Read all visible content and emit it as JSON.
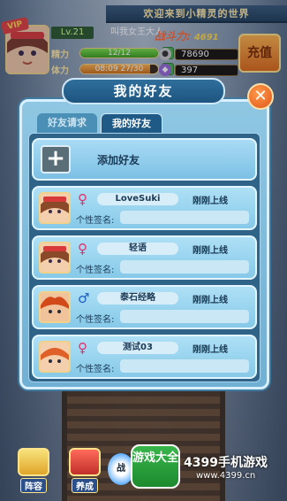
{
  "hud": {
    "banner": "欢迎来到小精灵的世界",
    "vip": "VIP",
    "level": "Lv.21",
    "player_name": "叫我女王大人",
    "power_label": "战斗力:",
    "power_value": "4691",
    "stamina_label": "精力",
    "stamina_text": "12/12",
    "stamina_fraction": 1.0,
    "energy_label": "体力",
    "energy_text": "08:09 27/30",
    "energy_fraction": 0.9,
    "plus": "+",
    "coins": "78690",
    "gems": "397",
    "recharge": "充值"
  },
  "modal": {
    "title": "我的好友",
    "close": "✕",
    "tabs": [
      "好友请求",
      "我的好友"
    ],
    "add_friend": "添加好友",
    "add_icon": "+",
    "signature_label": "个性签名:",
    "friends": [
      {
        "gender": "♀",
        "gender_color": "#d9336b",
        "name": "LoveSuki",
        "status": "刚刚上线"
      },
      {
        "gender": "♀",
        "gender_color": "#d9336b",
        "name": "轻语",
        "status": "刚刚上线"
      },
      {
        "gender": "♂",
        "gender_color": "#1f5fc0",
        "name": "泰石经略",
        "status": "刚刚上线"
      },
      {
        "gender": "♀",
        "gender_color": "#d9336b",
        "name": "测试03",
        "status": "刚刚上线"
      }
    ]
  },
  "bottom": {
    "lineup": "阵容",
    "cultivate": "养成",
    "battle": "战",
    "game_badge": "游戏大全",
    "brand": "4399手机游戏",
    "brand_url": "www.4399.cn"
  },
  "colors": {
    "accent": "#1f5a86",
    "panel": "#8fc7e3",
    "female": "#d9336b",
    "male": "#1f5fc0"
  }
}
